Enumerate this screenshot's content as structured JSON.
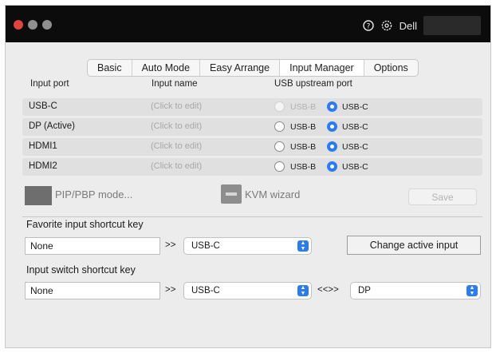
{
  "titlebar": {
    "help_icon": "question-circle-icon",
    "settings_icon": "gear-icon",
    "brand": "Dell"
  },
  "tabs": [
    {
      "label": "Basic",
      "active": false
    },
    {
      "label": "Auto Mode",
      "active": false
    },
    {
      "label": "Easy Arrange",
      "active": false
    },
    {
      "label": "Input Manager",
      "active": true
    },
    {
      "label": "Options",
      "active": false
    }
  ],
  "table": {
    "headers": {
      "port": "Input port",
      "name": "Input name",
      "usb": "USB upstream port"
    },
    "rows": [
      {
        "port": "USB-C",
        "name": "(Click to edit)",
        "usb_b": "USB-B",
        "usb_c": "USB-C",
        "selected": "USB-C",
        "usb_b_disabled": true
      },
      {
        "port": "DP (Active)",
        "name": "(Click to edit)",
        "usb_b": "USB-B",
        "usb_c": "USB-C",
        "selected": "USB-C",
        "usb_b_disabled": false
      },
      {
        "port": "HDMI1",
        "name": "(Click to edit)",
        "usb_b": "USB-B",
        "usb_c": "USB-C",
        "selected": "USB-C",
        "usb_b_disabled": false
      },
      {
        "port": "HDMI2",
        "name": "(Click to edit)",
        "usb_b": "USB-B",
        "usb_c": "USB-C",
        "selected": "USB-C",
        "usb_b_disabled": false
      }
    ]
  },
  "actions": {
    "pip_label": "PIP/PBP mode...",
    "kvm_label": "KVM wizard",
    "save_label": "Save"
  },
  "favorite": {
    "label": "Favorite input shortcut key",
    "shortcut_value": "None",
    "arrows": ">>",
    "select_value": "USB-C",
    "change_button": "Change active input"
  },
  "switch": {
    "label": "Input switch shortcut key",
    "shortcut_value": "None",
    "arrows": ">>",
    "select_a": "USB-C",
    "swap": "<<>>",
    "select_b": "DP"
  },
  "colors": {
    "accent": "#2b7bf4",
    "titlebar": "#0c0c0c",
    "close": "#e0443e"
  }
}
